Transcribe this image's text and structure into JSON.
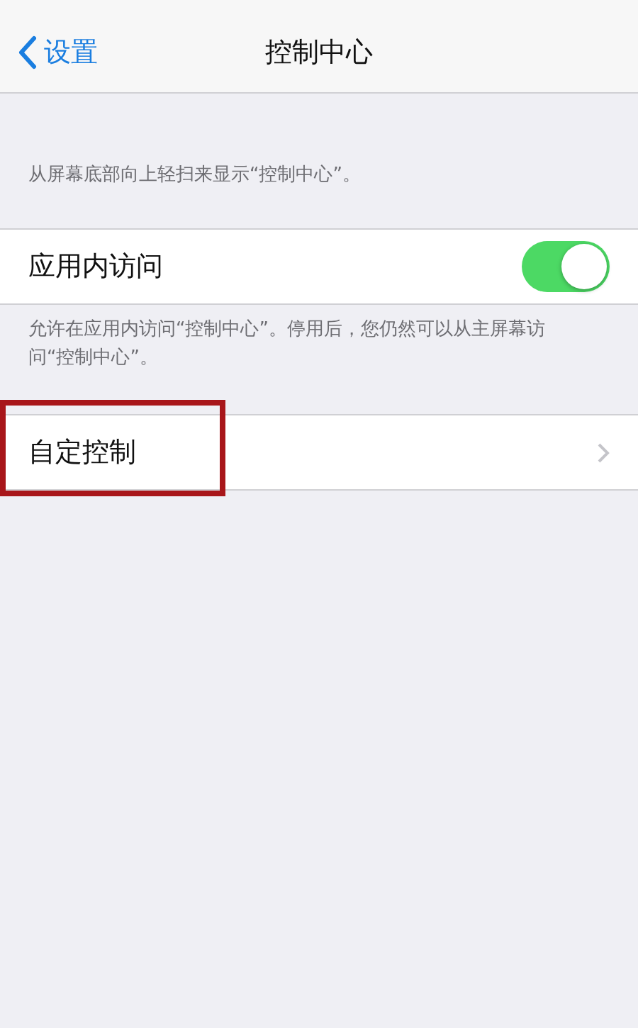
{
  "nav": {
    "back_label": "设置",
    "title": "控制中心"
  },
  "header_note": "从屏幕底部向上轻扫来显示“控制中心”。",
  "rows": [
    {
      "kind": "toggle",
      "label": "应用内访问",
      "on": true,
      "footer": "允许在应用内访问“控制中心”。停用后，您仍然可以从主屏幕访问“控制中心”。"
    },
    {
      "kind": "link",
      "label": "自定控制",
      "highlighted": true
    }
  ]
}
